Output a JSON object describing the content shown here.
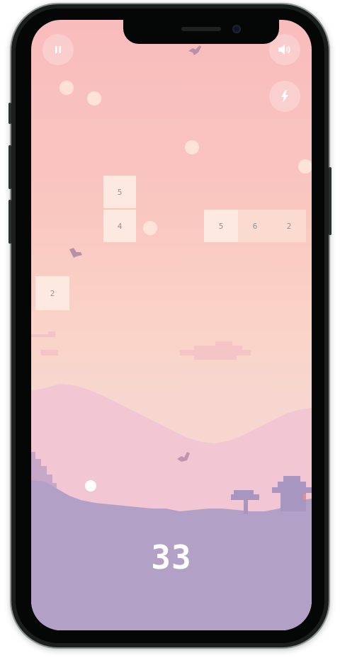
{
  "controls": {
    "pause_icon": "pause-icon",
    "sound_icon": "speaker-volume-icon",
    "power_icon": "lightning-bolt-icon"
  },
  "blocks": [
    {
      "value": "5"
    },
    {
      "value": "4"
    },
    {
      "value": "5"
    },
    {
      "value": "6"
    },
    {
      "value": "2"
    },
    {
      "value": "2"
    }
  ],
  "score": "33",
  "colors": {
    "sky_top": "#f8bcbc",
    "sky_bottom": "#f6d6cf",
    "hills": "#f2c4d0",
    "ground": "#b3a0c7",
    "block_light": "#fde9df",
    "block_dark": "#fbdad0",
    "ball": "#fde3d8",
    "score_text": "#ffffff"
  }
}
